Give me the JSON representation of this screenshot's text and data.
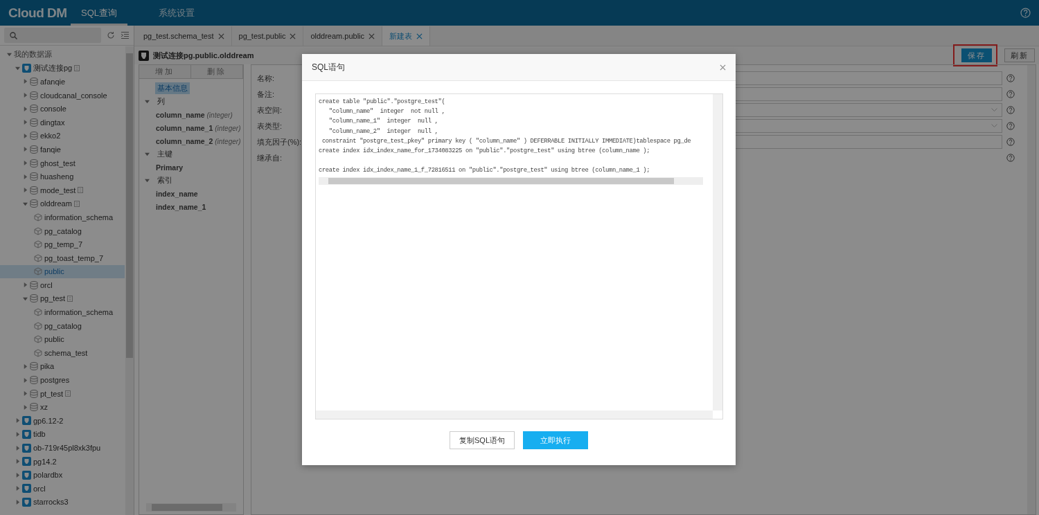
{
  "header": {
    "logo": "Cloud DM",
    "nav": [
      {
        "label": "SQL查询",
        "selected": true
      },
      {
        "label": "系统设置",
        "selected": false
      }
    ]
  },
  "sidebar": {
    "tree": [
      {
        "label": "我的数据源",
        "kind": "root",
        "expanded": true,
        "selected": false,
        "badge": false,
        "children": [
          {
            "label": "测试连接pg",
            "kind": "connection",
            "expanded": true,
            "selected": false,
            "badge": true,
            "children": [
              {
                "label": "afanqie",
                "kind": "database",
                "expanded": false,
                "selected": false,
                "badge": false
              },
              {
                "label": "cloudcanal_console",
                "kind": "database",
                "expanded": false,
                "selected": false,
                "badge": false
              },
              {
                "label": "console",
                "kind": "database",
                "expanded": false,
                "selected": false,
                "badge": false
              },
              {
                "label": "dingtax",
                "kind": "database",
                "expanded": false,
                "selected": false,
                "badge": false
              },
              {
                "label": "ekko2",
                "kind": "database",
                "expanded": false,
                "selected": false,
                "badge": false
              },
              {
                "label": "fanqie",
                "kind": "database",
                "expanded": false,
                "selected": false,
                "badge": false
              },
              {
                "label": "ghost_test",
                "kind": "database",
                "expanded": false,
                "selected": false,
                "badge": false
              },
              {
                "label": "huasheng",
                "kind": "database",
                "expanded": false,
                "selected": false,
                "badge": false
              },
              {
                "label": "mode_test",
                "kind": "database",
                "expanded": false,
                "selected": false,
                "badge": true
              },
              {
                "label": "olddream",
                "kind": "database",
                "expanded": true,
                "selected": false,
                "badge": true,
                "children": [
                  {
                    "label": "information_schema",
                    "kind": "schema",
                    "selected": false,
                    "badge": false
                  },
                  {
                    "label": "pg_catalog",
                    "kind": "schema",
                    "selected": false,
                    "badge": false
                  },
                  {
                    "label": "pg_temp_7",
                    "kind": "schema",
                    "selected": false,
                    "badge": false
                  },
                  {
                    "label": "pg_toast_temp_7",
                    "kind": "schema",
                    "selected": false,
                    "badge": false
                  },
                  {
                    "label": "public",
                    "kind": "schema",
                    "selected": true,
                    "badge": false
                  }
                ]
              },
              {
                "label": "orcl",
                "kind": "database",
                "expanded": false,
                "selected": false,
                "badge": false
              },
              {
                "label": "pg_test",
                "kind": "database",
                "expanded": true,
                "selected": false,
                "badge": true,
                "children": [
                  {
                    "label": "information_schema",
                    "kind": "schema",
                    "selected": false,
                    "badge": false
                  },
                  {
                    "label": "pg_catalog",
                    "kind": "schema",
                    "selected": false,
                    "badge": false
                  },
                  {
                    "label": "public",
                    "kind": "schema",
                    "selected": false,
                    "badge": false
                  },
                  {
                    "label": "schema_test",
                    "kind": "schema",
                    "selected": false,
                    "badge": false
                  }
                ]
              },
              {
                "label": "pika",
                "kind": "database",
                "expanded": false,
                "selected": false,
                "badge": false
              },
              {
                "label": "postgres",
                "kind": "database",
                "expanded": false,
                "selected": false,
                "badge": false
              },
              {
                "label": "pt_test",
                "kind": "database",
                "expanded": false,
                "selected": false,
                "badge": true
              },
              {
                "label": "xz",
                "kind": "database",
                "expanded": false,
                "selected": false,
                "badge": false
              }
            ]
          },
          {
            "label": "gp6.12-2",
            "kind": "connection",
            "expanded": false,
            "selected": false,
            "badge": false
          },
          {
            "label": "tidb",
            "kind": "connection",
            "expanded": false,
            "selected": false,
            "badge": false
          },
          {
            "label": "ob-719r45pl8xk3fpu",
            "kind": "connection",
            "expanded": false,
            "selected": false,
            "badge": false
          },
          {
            "label": "pg14.2",
            "kind": "connection",
            "expanded": false,
            "selected": false,
            "badge": false
          },
          {
            "label": "polardbx",
            "kind": "connection",
            "expanded": false,
            "selected": false,
            "badge": false
          },
          {
            "label": "orcl",
            "kind": "connection",
            "expanded": false,
            "selected": false,
            "badge": false
          },
          {
            "label": "starrocks3",
            "kind": "connection",
            "expanded": false,
            "selected": false,
            "badge": false
          }
        ]
      }
    ]
  },
  "tabs": [
    {
      "label": "pg_test.schema_test",
      "selected": false
    },
    {
      "label": "pg_test.public",
      "selected": false
    },
    {
      "label": "olddream.public",
      "selected": false
    },
    {
      "label": "新建表",
      "selected": true
    }
  ],
  "editor": {
    "title": "测试连接pg.public.olddream",
    "toolbar": [
      {
        "label": "增加"
      },
      {
        "label": "删除"
      }
    ],
    "object_tree": [
      {
        "label": "基本信息",
        "selected": true
      },
      {
        "label": "列",
        "expanded": true,
        "selected": false,
        "children": [
          {
            "label": "column_name",
            "type": "(integer)",
            "selected": false
          },
          {
            "label": "column_name_1",
            "type": "(integer)",
            "selected": false
          },
          {
            "label": "column_name_2",
            "type": "(integer)",
            "selected": false
          }
        ]
      },
      {
        "label": "主键",
        "expanded": true,
        "selected": false,
        "children": [
          {
            "label": "Primary",
            "selected": false
          }
        ]
      },
      {
        "label": "索引",
        "expanded": true,
        "selected": false,
        "children": [
          {
            "label": "index_name",
            "selected": false
          },
          {
            "label": "index_name_1",
            "selected": false
          }
        ]
      }
    ],
    "actions": [
      {
        "label": "保存",
        "kind": "primary",
        "highlighted": true
      },
      {
        "label": "刷新",
        "kind": "default",
        "highlighted": false
      }
    ],
    "fields": [
      {
        "label": "名称:",
        "kind": "text"
      },
      {
        "label": "备注:",
        "kind": "text"
      },
      {
        "label": "表空间:",
        "kind": "select"
      },
      {
        "label": "表类型:",
        "kind": "select"
      },
      {
        "label": "填充因子(%):",
        "kind": "text"
      },
      {
        "label": "继承自:",
        "kind": "none"
      }
    ]
  },
  "dialog": {
    "title": "SQL语句",
    "code": [
      [
        "create table \"public\".\"postgre_test\"(",
        "   \"column_name\"  integer  not null ,",
        "   \"column_name_1\"  integer  null ,",
        "   \"column_name_2\"  integer  null ,",
        " constraint \"postgre_test_pkey\" primary key ( \"column_name\" ) DEFERRABLE INITIALLY IMMEDIATE)tablespace pg_de",
        "create index idx_index_name_for_1734083225 on \"public\".\"postgre_test\" using btree (column_name );"
      ],
      [
        "create index idx_index_name_1_f_72816511 on \"public\".\"postgre_test\" using btree (column_name_1 );"
      ]
    ],
    "buttons": [
      {
        "label": "复制SQL语句",
        "kind": "default"
      },
      {
        "label": "立即执行",
        "kind": "primary"
      }
    ]
  }
}
